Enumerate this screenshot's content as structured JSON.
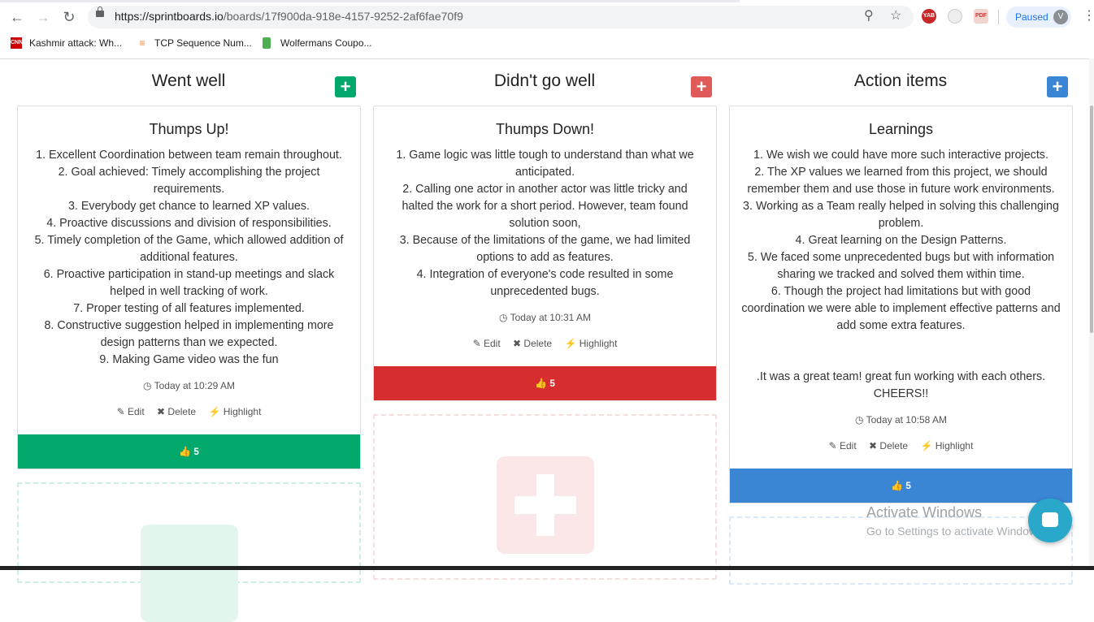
{
  "browser": {
    "url_host": "https://sprintboards.io",
    "url_path": "/boards/17f900da-918e-4157-9252-2af6fae70f9",
    "profile_status": "Paused",
    "profile_initial": "V",
    "ext_labels": [
      "YAB",
      "PDF"
    ],
    "bookmarks": [
      {
        "icon": "CNN",
        "label": "Kashmir attack: Wh..."
      },
      {
        "icon": "",
        "label": "TCP Sequence Num..."
      },
      {
        "icon": "",
        "label": "Wolfermans Coupo..."
      }
    ]
  },
  "columns": [
    {
      "header": "Went well",
      "color": "#00a86b",
      "card": {
        "title": "Thumps Up!",
        "lines": [
          "1. Excellent Coordination between team remain throughout.",
          "2. Goal achieved: Timely accomplishing the project requirements.",
          "3. Everybody get chance to learned XP values.",
          "4. Proactive discussions and division of responsibilities.",
          "5. Timely completion of the Game, which allowed addition of additional features.",
          "6. Proactive participation in stand-up meetings and slack helped in well tracking of work.",
          "7. Proper testing of all features implemented.",
          "8. Constructive suggestion helped in implementing more design patterns than we expected.",
          "9. Making Game video was the fun"
        ],
        "time": "Today at 10:29 AM",
        "votes": "5"
      }
    },
    {
      "header": "Didn't go well",
      "color": "#d62e2e",
      "card": {
        "title": "Thumps Down!",
        "lines": [
          "1. Game logic was little tough to understand than what we anticipated.",
          "2. Calling one actor in another actor was little tricky and halted the work for a short period. However, team found solution soon,",
          "3. Because of the limitations of the game, we had limited options to add as features.",
          "4. Integration of everyone's code resulted in some unprecedented bugs."
        ],
        "time": "Today at 10:31 AM",
        "votes": "5"
      }
    },
    {
      "header": "Action items",
      "color": "#3a86d4",
      "card": {
        "title": "Learnings",
        "lines": [
          "1. We wish we could have more such interactive projects.",
          "2. The XP values we learned from this project, we should remember them and use those in future work environments.",
          "3. Working as a Team really helped in solving this challenging problem.",
          "4. Great learning on the Design Patterns.",
          "5. We faced some unprecedented bugs but with information sharing we tracked and solved them within time.",
          "6. Though the project had limitations but with good coordination we were able to implement effective patterns and add some extra features.",
          "",
          "",
          ".It was a great team! great fun working with each others. CHEERS!!"
        ],
        "time": "Today at 10:58 AM",
        "votes": "5"
      }
    }
  ],
  "card_actions": {
    "edit": "Edit",
    "delete": "Delete",
    "highlight": "Highlight"
  },
  "watermark": {
    "line1": "Activate Windows",
    "line2": "Go to Settings to activate Windows."
  }
}
